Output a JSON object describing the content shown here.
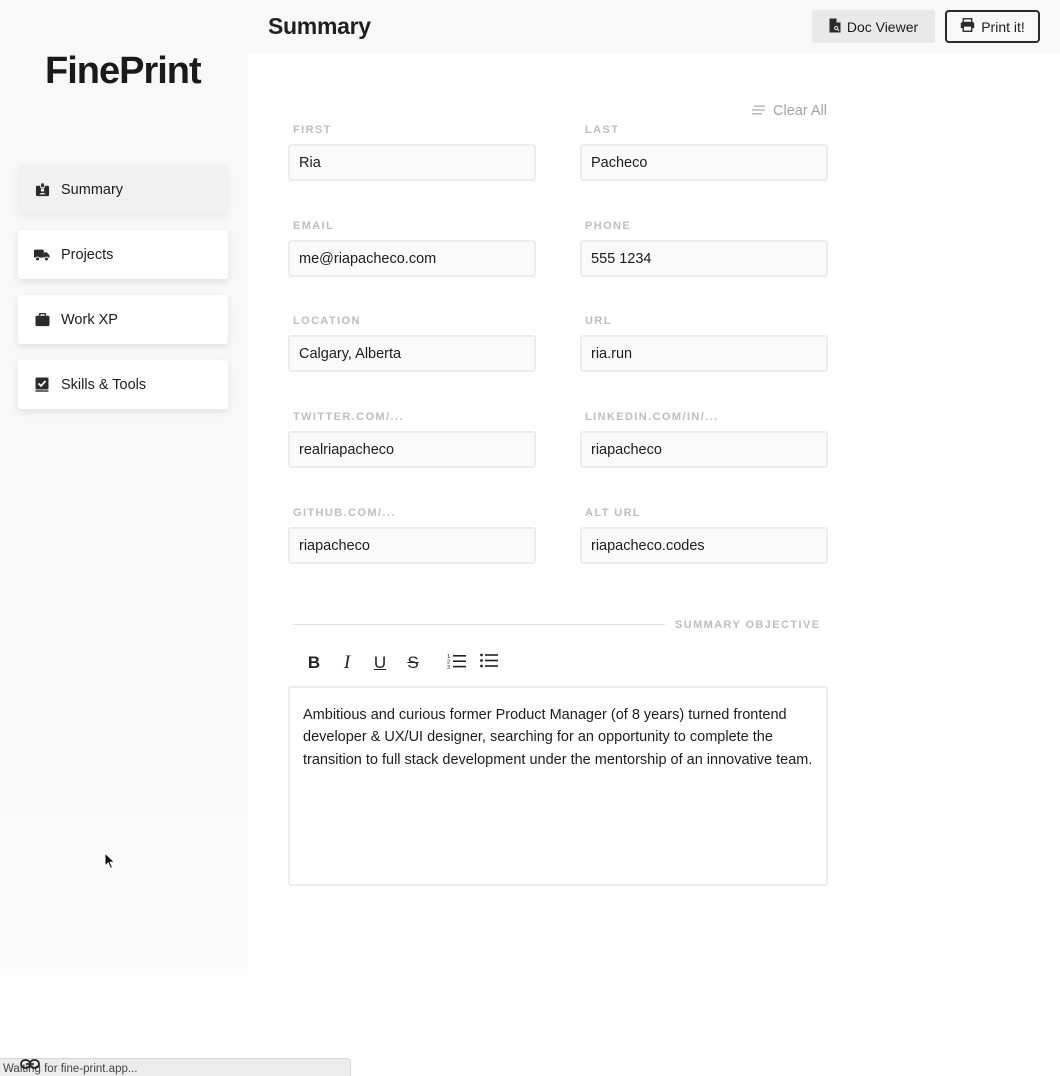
{
  "header": {
    "title": "Summary",
    "doc_viewer_label": "Doc Viewer",
    "print_label": "Print it!"
  },
  "sidebar": {
    "logo": "FinePrint",
    "items": [
      {
        "label": "Summary",
        "icon": "id-badge-icon",
        "active": true
      },
      {
        "label": "Projects",
        "icon": "truck-icon",
        "active": false
      },
      {
        "label": "Work XP",
        "icon": "briefcase-icon",
        "active": false
      },
      {
        "label": "Skills & Tools",
        "icon": "checkbox-icon",
        "active": false
      }
    ]
  },
  "form": {
    "clear_all_label": "Clear All",
    "fields": {
      "first": {
        "label": "FIRST",
        "value": "Ria"
      },
      "last": {
        "label": "LAST",
        "value": "Pacheco"
      },
      "email": {
        "label": "EMAIL",
        "value": "me@riapacheco.com"
      },
      "phone": {
        "label": "PHONE",
        "value": "555 1234"
      },
      "location": {
        "label": "LOCATION",
        "value": "Calgary, Alberta"
      },
      "url": {
        "label": "URL",
        "value": "ria.run"
      },
      "twitter": {
        "label": "TWITTER.COM/...",
        "value": "realriapacheco"
      },
      "linkedin": {
        "label": "LINKEDIN.COM/IN/...",
        "value": "riapacheco"
      },
      "github": {
        "label": "GITHUB.COM/...",
        "value": "riapacheco"
      },
      "alt_url": {
        "label": "ALT URL",
        "value": "riapacheco.codes"
      }
    }
  },
  "summary": {
    "section_title": "SUMMARY OBJECTIVE",
    "toolbar": [
      "bold-icon",
      "italic-icon",
      "underline-icon",
      "strikethrough-icon",
      "ordered-list-icon",
      "bullet-list-icon"
    ],
    "text": "Ambitious and curious former Product Manager (of 8 years) turned frontend developer & UX/UI designer, searching for an opportunity to complete the transition to full stack development under the mentorship of an innovative team."
  },
  "status_bar": {
    "text": "Waiting for fine-print.app..."
  },
  "colors": {
    "sidebar_bg": "#f8f8f8",
    "label_gray": "#bdbdbd",
    "input_border": "#ececec"
  }
}
